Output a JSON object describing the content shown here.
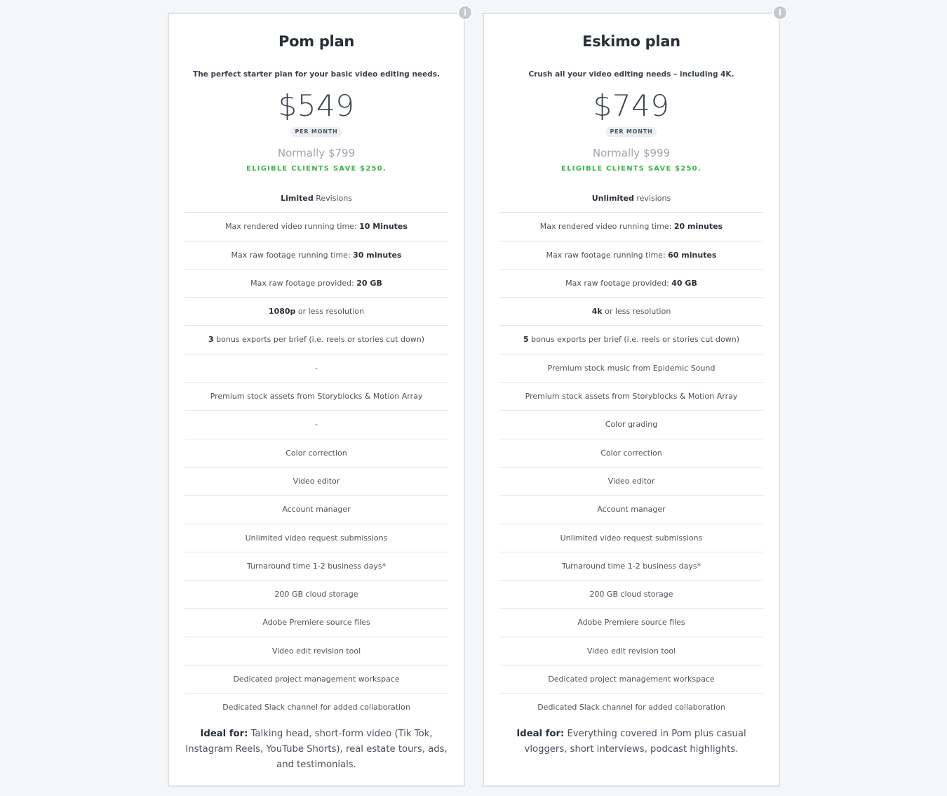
{
  "plans": [
    {
      "name": "Pom plan",
      "tagline": "The perfect starter plan for your basic video editing needs.",
      "price": "$549",
      "period": "PER MONTH",
      "normally": "Normally $799",
      "save": "ELIGIBLE CLIENTS SAVE $250.",
      "features": [
        {
          "bold": "Limited",
          "text": " Revisions"
        },
        {
          "text": "Max rendered video running time: ",
          "bold_after": "10 Minutes"
        },
        {
          "text": "Max raw footage running time: ",
          "bold_after": "30 minutes"
        },
        {
          "text": "Max raw footage provided: ",
          "bold_after": "20 GB"
        },
        {
          "bold": "1080p",
          "text": " or less resolution"
        },
        {
          "bold": "3",
          "text": " bonus exports per brief (i.e. reels or stories cut down)"
        },
        {
          "text": "-"
        },
        {
          "text": "Premium stock assets from Storyblocks & Motion Array"
        },
        {
          "text": "-"
        },
        {
          "text": "Color correction"
        },
        {
          "text": "Video editor"
        },
        {
          "text": "Account manager"
        },
        {
          "text": "Unlimited video request submissions"
        },
        {
          "text": "Turnaround time 1-2 business days*"
        },
        {
          "text": "200 GB cloud storage"
        },
        {
          "text": "Adobe Premiere source files"
        },
        {
          "text": "Video edit revision tool"
        },
        {
          "text": "Dedicated project management workspace"
        },
        {
          "text": "Dedicated Slack channel for added collaboration"
        }
      ],
      "ideal_label": "Ideal for:",
      "ideal_text": " Talking head, short-form video (Tik Tok, Instagram Reels, YouTube Shorts), real estate tours, ads, and testimonials."
    },
    {
      "name": "Eskimo plan",
      "tagline": "Crush all your video editing needs – including 4K.",
      "price": "$749",
      "period": "PER MONTH",
      "normally": "Normally $999",
      "save": "ELIGIBLE CLIENTS SAVE $250.",
      "features": [
        {
          "bold": "Unlimited",
          "text": " revisions"
        },
        {
          "text": "Max rendered video running time: ",
          "bold_after": "20 minutes"
        },
        {
          "text": "Max raw footage running time: ",
          "bold_after": "60 minutes"
        },
        {
          "text": "Max raw footage provided: ",
          "bold_after": "40 GB"
        },
        {
          "bold": "4k",
          "text": " or less resolution"
        },
        {
          "bold": "5",
          "text": " bonus exports per brief (i.e. reels or stories cut down)"
        },
        {
          "text": "Premium stock music from Epidemic Sound"
        },
        {
          "text": "Premium stock assets from Storyblocks & Motion Array"
        },
        {
          "text": "Color grading"
        },
        {
          "text": "Color correction"
        },
        {
          "text": "Video editor"
        },
        {
          "text": "Account manager"
        },
        {
          "text": "Unlimited video request submissions"
        },
        {
          "text": "Turnaround time 1-2 business days*"
        },
        {
          "text": "200 GB cloud storage"
        },
        {
          "text": "Adobe Premiere source files"
        },
        {
          "text": "Video edit revision tool"
        },
        {
          "text": "Dedicated project management workspace"
        },
        {
          "text": "Dedicated Slack channel for added collaboration"
        }
      ],
      "ideal_label": "Ideal for:",
      "ideal_text": " Everything covered in Pom plus casual vloggers, short interviews, podcast highlights."
    }
  ],
  "icons": {
    "info": "info-icon"
  },
  "colors": {
    "save_green": "#3bb54a",
    "background": "#f5f6f8",
    "card_border": "#dfe3e8"
  }
}
